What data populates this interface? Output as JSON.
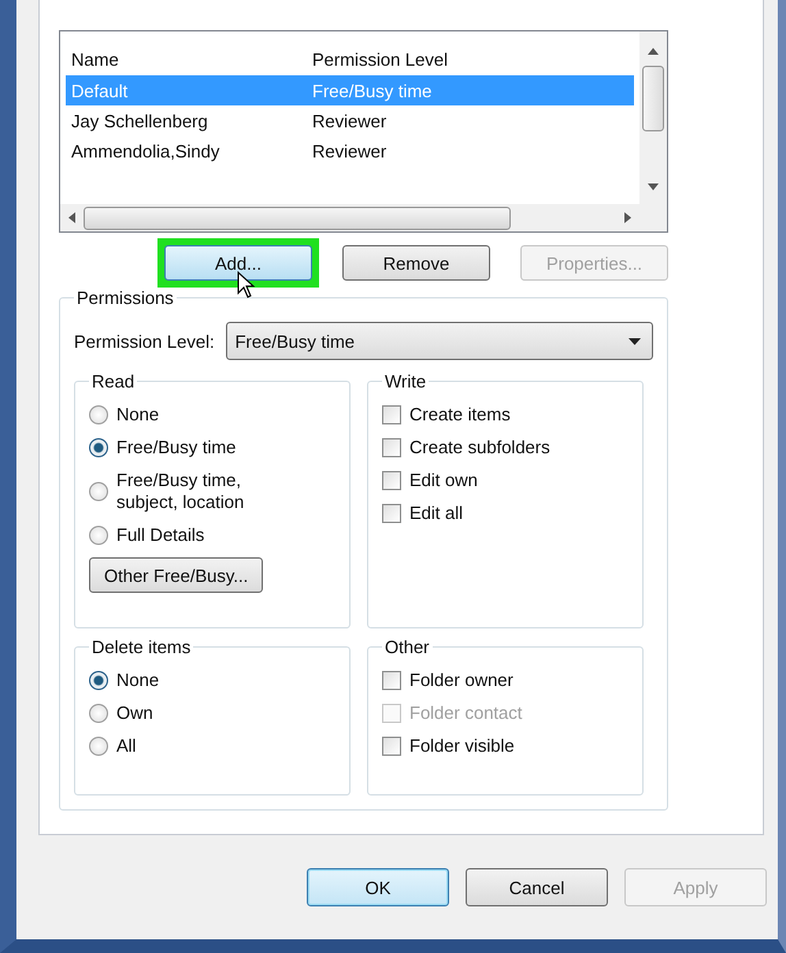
{
  "list": {
    "columns": [
      "Name",
      "Permission Level"
    ],
    "rows": [
      {
        "name": "Default",
        "level": "Free/Busy time",
        "selected": true
      },
      {
        "name": "Jay Schellenberg",
        "level": "Reviewer",
        "selected": false
      },
      {
        "name": "Ammendolia,Sindy",
        "level": "Reviewer",
        "selected": false
      }
    ]
  },
  "list_buttons": [
    {
      "label": "Add...",
      "disabled": false,
      "highlighted": true
    },
    {
      "label": "Remove",
      "disabled": false,
      "highlighted": false
    },
    {
      "label": "Properties...",
      "disabled": true,
      "highlighted": false
    }
  ],
  "permissions": {
    "title": "Permissions",
    "level_label": "Permission Level:",
    "level_value": "Free/Busy time",
    "read": {
      "title": "Read",
      "options": [
        {
          "label": "None",
          "selected": false
        },
        {
          "label": "Free/Busy time",
          "selected": true
        },
        {
          "label": "Free/Busy time,\nsubject, location",
          "selected": false
        },
        {
          "label": "Full Details",
          "selected": false
        }
      ],
      "button": "Other Free/Busy..."
    },
    "write": {
      "title": "Write",
      "items": [
        {
          "label": "Create items",
          "checked": false,
          "disabled": false
        },
        {
          "label": "Create subfolders",
          "checked": false,
          "disabled": false
        },
        {
          "label": "Edit own",
          "checked": false,
          "disabled": false
        },
        {
          "label": "Edit all",
          "checked": false,
          "disabled": false
        }
      ]
    },
    "delete": {
      "title": "Delete items",
      "options": [
        {
          "label": "None",
          "selected": true
        },
        {
          "label": "Own",
          "selected": false
        },
        {
          "label": "All",
          "selected": false
        }
      ]
    },
    "other": {
      "title": "Other",
      "items": [
        {
          "label": "Folder owner",
          "checked": false,
          "disabled": false
        },
        {
          "label": "Folder contact",
          "checked": false,
          "disabled": true
        },
        {
          "label": "Folder visible",
          "checked": false,
          "disabled": false
        }
      ]
    }
  },
  "footer_buttons": [
    {
      "label": "OK",
      "default": true,
      "disabled": false
    },
    {
      "label": "Cancel",
      "default": false,
      "disabled": false
    },
    {
      "label": "Apply",
      "default": false,
      "disabled": true
    }
  ]
}
